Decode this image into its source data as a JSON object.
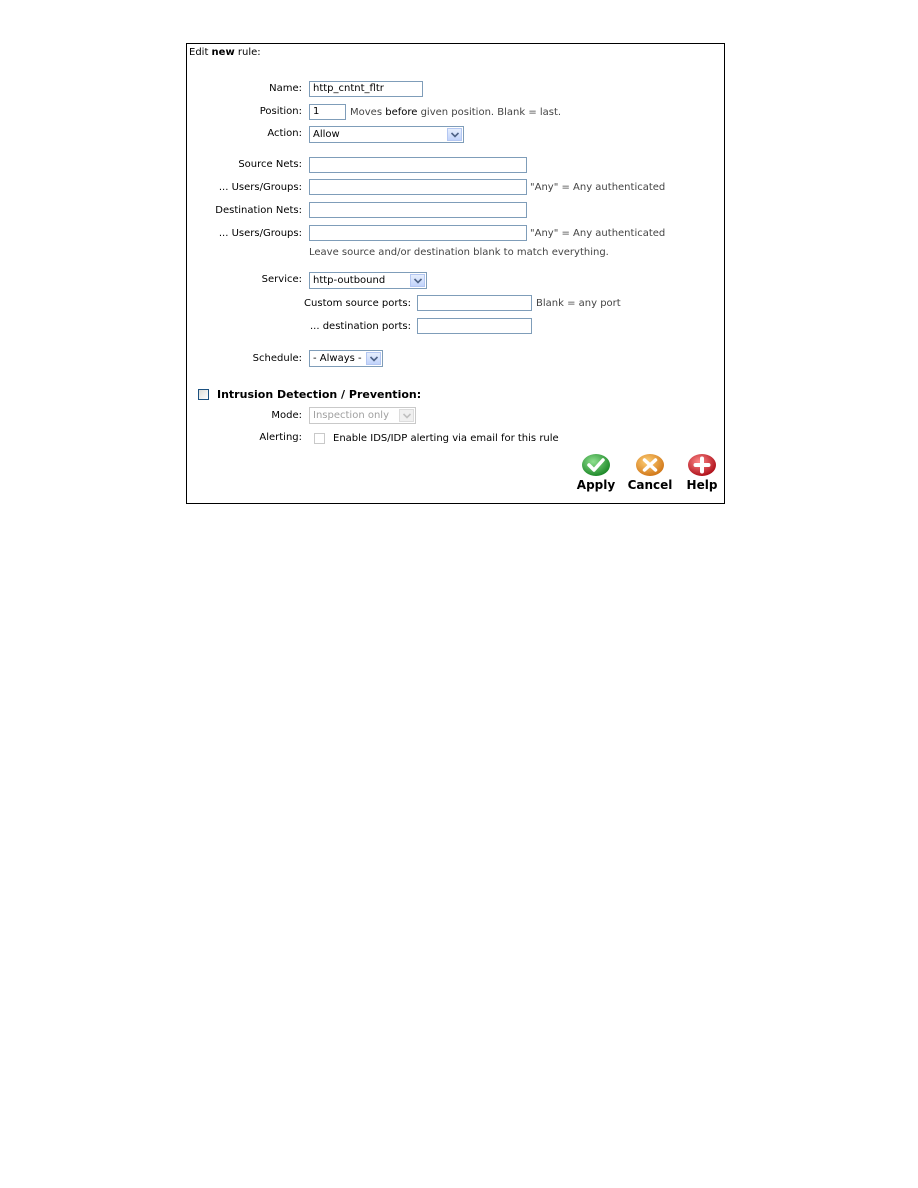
{
  "form": {
    "title_prefix": "Edit ",
    "title_bold": "new",
    "title_suffix": " rule:",
    "name": {
      "label": "Name:",
      "value": "http_cntnt_fltr"
    },
    "position": {
      "label": "Position:",
      "value": "1",
      "hint_prefix": "Moves ",
      "hint_bold": "before",
      "hint_suffix": " given position. Blank = last."
    },
    "action": {
      "label": "Action:",
      "selected": "Allow"
    },
    "source_nets": {
      "label": "Source Nets:",
      "value": ""
    },
    "source_users": {
      "label": "... Users/Groups:",
      "value": "",
      "hint": "\"Any\" = Any authenticated"
    },
    "destination_nets": {
      "label": "Destination Nets:",
      "value": ""
    },
    "destination_users": {
      "label": "... Users/Groups:",
      "value": "",
      "hint": "\"Any\" = Any authenticated"
    },
    "match_hint": "Leave source and/or destination blank to match everything.",
    "service": {
      "label": "Service:",
      "selected": "http-outbound"
    },
    "custom_source_ports": {
      "label": "Custom source ports:",
      "value": "",
      "hint": "Blank = any port"
    },
    "destination_ports": {
      "label": "... destination ports:",
      "value": ""
    },
    "schedule": {
      "label": "Schedule:",
      "selected": "- Always -"
    },
    "ids": {
      "checked": false,
      "heading": "Intrusion Detection / Prevention:",
      "mode": {
        "label": "Mode:",
        "selected": "Inspection only"
      },
      "alerting": {
        "label": "Alerting:",
        "checked": false,
        "text": "Enable IDS/IDP alerting via email for this rule"
      }
    }
  },
  "buttons": {
    "apply": {
      "label": "Apply",
      "icon": "checkmark-icon",
      "color": "#2e9a2e"
    },
    "cancel": {
      "label": "Cancel",
      "icon": "x-icon",
      "color": "#e58a1f"
    },
    "help": {
      "label": "Help",
      "icon": "plus-icon",
      "color": "#c8202a"
    }
  }
}
